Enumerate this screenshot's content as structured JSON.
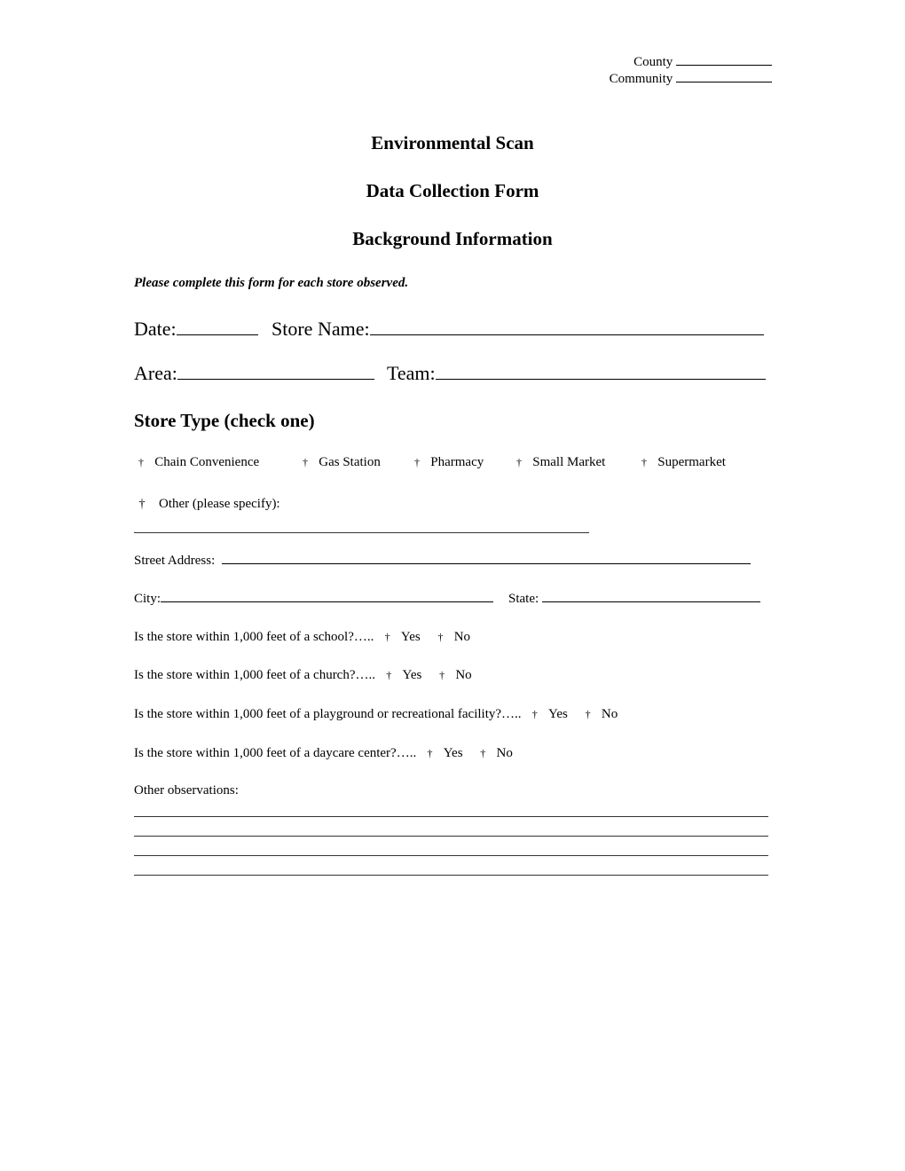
{
  "header": {
    "county_label": "County",
    "community_label": "Community"
  },
  "titles": {
    "main": "Environmental Scan",
    "sub": "Data Collection Form",
    "section": "Background Information"
  },
  "instruction": "Please complete this form for each store observed.",
  "fields": {
    "date_label": "Date:",
    "store_name_label": "Store Name:",
    "area_label": "Area:",
    "team_label": "Team:",
    "street_address_label": "Street Address:",
    "city_label": "City:",
    "state_label": "State:",
    "date_value": "",
    "store_name_value": "",
    "area_value": "",
    "team_value": "",
    "street_address_value": "",
    "city_value": "",
    "state_value": ""
  },
  "store_type": {
    "heading": "Store Type (check one)",
    "checkbox_glyph": "†",
    "options": [
      "Chain Convenience",
      "Gas Station",
      "Pharmacy",
      "Small Market",
      "Supermarket"
    ],
    "other_label": "Other (please specify):"
  },
  "questions": [
    {
      "text": "Is the store within 1,000 feet of a school?…..",
      "yes": "Yes",
      "no": "No"
    },
    {
      "text": "Is the store within 1,000 feet of a church?…..",
      "yes": "Yes",
      "no": "No"
    },
    {
      "text": "Is the store within 1,000 feet of a playground or recreational facility?…..",
      "yes": "Yes",
      "no": "No"
    },
    {
      "text": "Is the store within 1,000 feet of a daycare center?…..",
      "yes": "Yes",
      "no": "No"
    }
  ],
  "observations": {
    "label": "Other observations:"
  }
}
